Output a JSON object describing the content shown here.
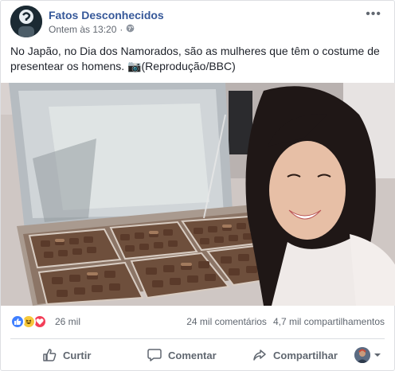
{
  "header": {
    "page_name": "Fatos Desconhecidos",
    "timestamp": "Ontem às 13:20",
    "separator": "·",
    "more": "•••"
  },
  "post": {
    "text": "No Japão, no Dia dos Namorados, são as mulheres que têm o costume de presentear os homens. 📷(Reprodução/BBC)"
  },
  "reactions": {
    "count": "26 mil",
    "comments": "24 mil comentários",
    "shares": "4,7 mil compartilhamentos"
  },
  "actions": {
    "like": "Curtir",
    "comment": "Comentar",
    "share": "Compartilhar"
  },
  "colors": {
    "link": "#365899",
    "like": "#4080ff",
    "haha": "#f7c93b",
    "love": "#f33e58"
  }
}
